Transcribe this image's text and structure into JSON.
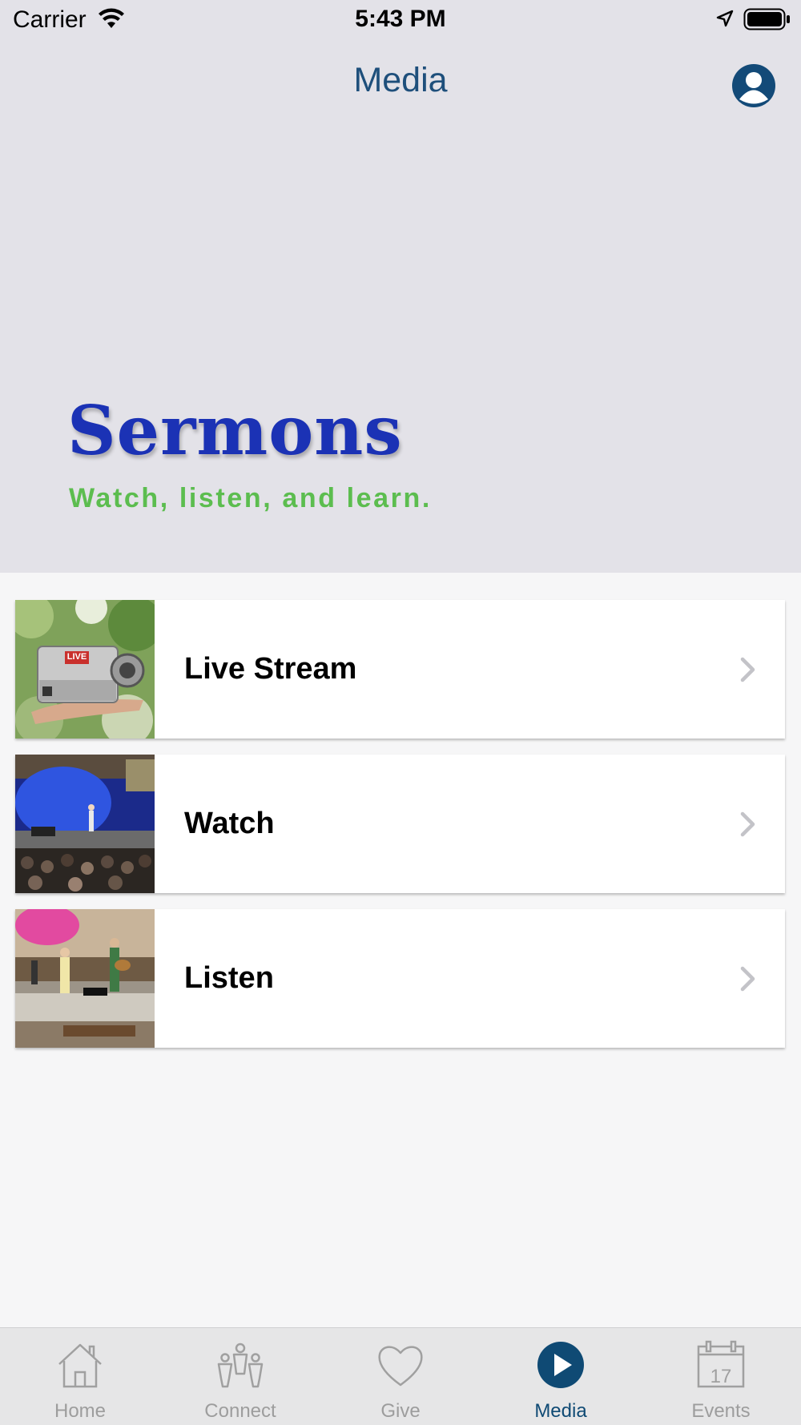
{
  "status_bar": {
    "carrier": "Carrier",
    "time": "5:43 PM"
  },
  "nav": {
    "title": "Media"
  },
  "hero": {
    "title": "Sermons",
    "subtitle": "Watch, listen, and learn."
  },
  "menu": [
    {
      "label": "Live Stream",
      "thumb_badge": "LIVE"
    },
    {
      "label": "Watch"
    },
    {
      "label": "Listen"
    }
  ],
  "tabs": [
    {
      "label": "Home",
      "icon": "house-icon"
    },
    {
      "label": "Connect",
      "icon": "people-icon"
    },
    {
      "label": "Give",
      "icon": "heart-icon"
    },
    {
      "label": "Media",
      "icon": "play-icon",
      "active": true
    },
    {
      "label": "Events",
      "icon": "calendar-icon",
      "badge": "17"
    }
  ],
  "colors": {
    "accent": "#0f4a74",
    "hero_title": "#1b32b5",
    "hero_subtitle": "#5cbd4f",
    "hero_bg": "#e3e2e8"
  }
}
